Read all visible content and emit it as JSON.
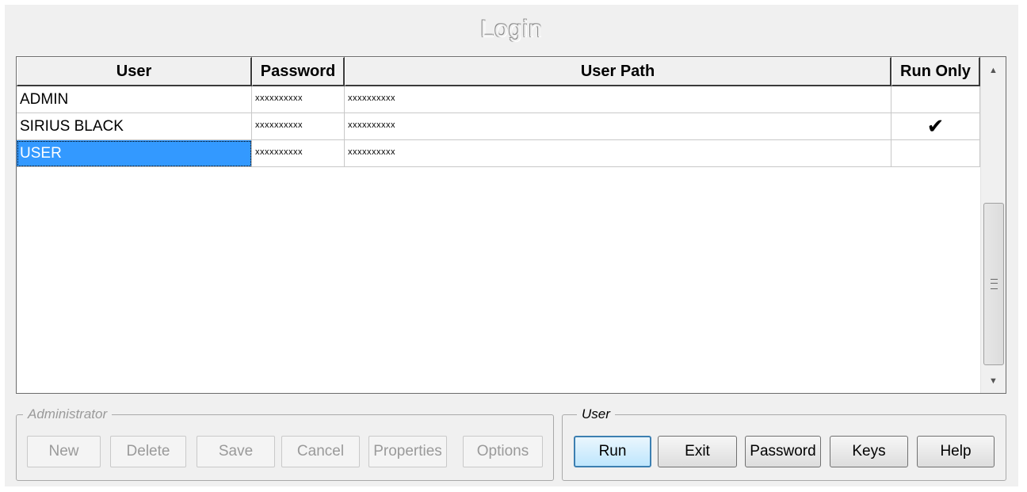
{
  "window": {
    "title": "Login"
  },
  "grid": {
    "columns": [
      "User",
      "Password",
      "User Path",
      "Run Only"
    ],
    "rows": [
      {
        "user": "ADMIN",
        "password": "xxxxxxxxxx",
        "path": "xxxxxxxxxx",
        "run_only": ""
      },
      {
        "user": "SIRIUS BLACK",
        "password": "xxxxxxxxxx",
        "path": "xxxxxxxxxx",
        "run_only": "✔"
      },
      {
        "user": "USER",
        "password": "xxxxxxxxxx",
        "path": "xxxxxxxxxx",
        "run_only": ""
      }
    ],
    "selected_row": 2
  },
  "admin_group": {
    "legend": "Administrator",
    "buttons": [
      "New",
      "Delete",
      "Save",
      "Cancel",
      "Properties",
      "Options"
    ]
  },
  "user_group": {
    "legend": "User",
    "buttons": [
      "Run",
      "Exit",
      "Password",
      "Keys",
      "Help"
    ]
  }
}
